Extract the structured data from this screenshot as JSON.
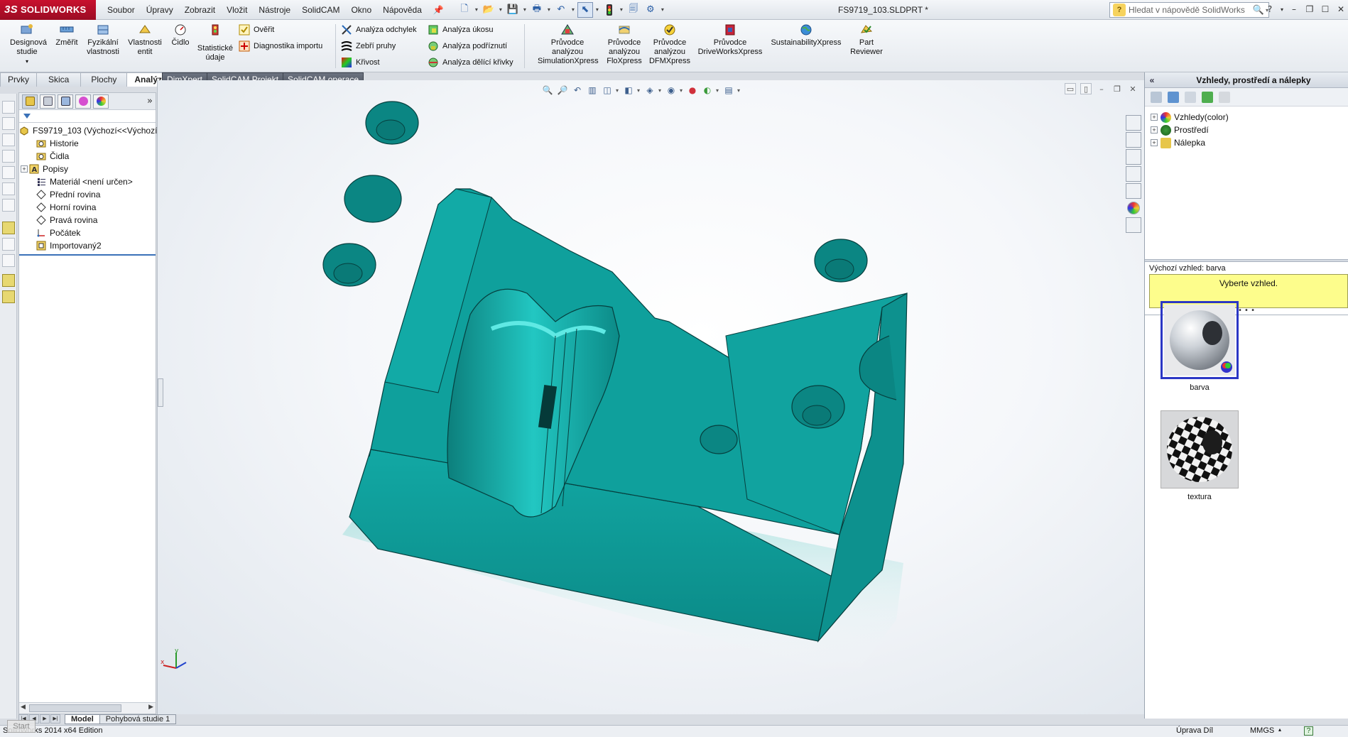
{
  "app": {
    "brand": "SOLIDWORKS",
    "document_title": "FS9719_103.SLDPRT *"
  },
  "menu": [
    "Soubor",
    "Úpravy",
    "Zobrazit",
    "Vložit",
    "Nástroje",
    "SolidCAM",
    "Okno",
    "Nápověda"
  ],
  "help_search": {
    "placeholder": "Hledat v nápovědě SolidWorks"
  },
  "commands": {
    "design_study": "Designová studie",
    "measure": "Změřit",
    "mass_props": "Fyzikální vlastnosti",
    "section_props": "Vlastnosti entit",
    "sensor": "Čidlo",
    "statistics": "Statistické údaje",
    "check": "Ověřit",
    "import_diag": "Diagnostika importu",
    "deviation": "Analýza odchylek",
    "zebra": "Zebří pruhy",
    "curvature": "Křivost",
    "draft": "Analýza úkosu",
    "undercut": "Analýza podříznutí",
    "parting": "Analýza dělící křivky",
    "sim_xpress": "Průvodce analýzou SimulationXpress",
    "flo_xpress": "Průvodce analýzou FloXpress",
    "dfm_xpress": "Průvodce analýzou DFMXpress",
    "driveworks": "Průvodce DriveWorksXpress",
    "sustainability": "SustainabilityXpress",
    "part_reviewer": "Part Reviewer"
  },
  "tabs": [
    "Prvky",
    "Skica",
    "Plochy",
    "Analýzy",
    "DimXpert",
    "SolidCAM Projekt",
    "SolidCAM operace"
  ],
  "active_tab": "Analýzy",
  "feature_tree": {
    "root": "FS9719_103  (Výchozí<<Výchozí",
    "items": [
      {
        "label": "Historie",
        "icon": "history-folder-icon"
      },
      {
        "label": "Čidla",
        "icon": "sensors-folder-icon"
      },
      {
        "label": "Popisy",
        "icon": "annotations-icon"
      },
      {
        "label": "Materiál <není určen>",
        "icon": "material-icon"
      },
      {
        "label": "Přední rovina",
        "icon": "plane-icon"
      },
      {
        "label": "Horní rovina",
        "icon": "plane-icon"
      },
      {
        "label": "Pravá rovina",
        "icon": "plane-icon"
      },
      {
        "label": "Počátek",
        "icon": "origin-icon"
      },
      {
        "label": "Importovaný2",
        "icon": "imported-body-icon"
      }
    ]
  },
  "task_pane": {
    "title": "Vzhledy, prostředí a nálepky",
    "tree": [
      "Vzhledy(color)",
      "Prostředí",
      "Nálepka"
    ],
    "default_appearance": "Výchozí vzhled: barva",
    "prompt": "Vyberte vzhled.",
    "swatches": [
      {
        "label": "barva",
        "selected": true
      },
      {
        "label": "textura",
        "selected": false
      }
    ]
  },
  "bottom_tabs": [
    "Model",
    "Pohybová studie 1"
  ],
  "status": {
    "edition": "SolidWorks 2014 x64 Edition",
    "mode": "Úprava Díl",
    "units": "MMGS",
    "start": "Start"
  },
  "colors": {
    "model": "#0e9a97",
    "accent": "#3a71b8",
    "prompt_bg": "#fdfd8c",
    "brand": "#c8102e"
  }
}
